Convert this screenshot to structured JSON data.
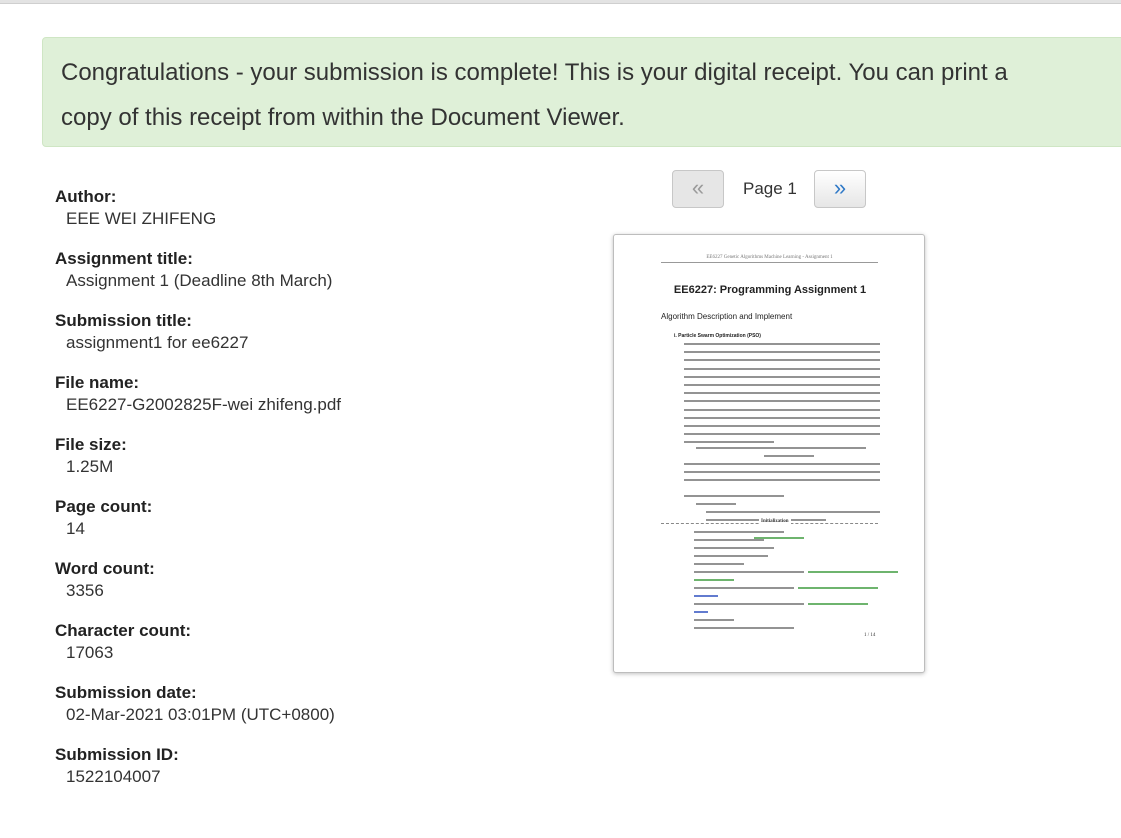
{
  "banner": {
    "line1": "Congratulations - your submission is complete! This is your digital receipt. You can print a",
    "line2": "copy of this receipt from within the Document Viewer."
  },
  "details": [
    {
      "label": "Author:",
      "value": "EEE WEI ZHIFENG"
    },
    {
      "label": "Assignment title:",
      "value": "Assignment 1 (Deadline 8th March)"
    },
    {
      "label": "Submission title:",
      "value": "assignment1 for ee6227"
    },
    {
      "label": "File name:",
      "value": "EE6227-G2002825F-wei zhifeng.pdf"
    },
    {
      "label": "File size:",
      "value": "1.25M"
    },
    {
      "label": "Page count:",
      "value": "14"
    },
    {
      "label": "Word count:",
      "value": "3356"
    },
    {
      "label": "Character count:",
      "value": "17063"
    },
    {
      "label": "Submission date:",
      "value": "02-Mar-2021 03:01PM (UTC+0800)"
    },
    {
      "label": "Submission ID:",
      "value": "1522104007"
    }
  ],
  "pager": {
    "prev_symbol": "«",
    "page_label": "Page 1",
    "next_symbol": "»"
  },
  "document_preview": {
    "header": "EE6227 Genetic Algorithms Machine Learning - Assignment 1",
    "title": "EE6227: Programming Assignment 1",
    "subtitle": "Algorithm Description and Implement",
    "section_heading": "i.    Particle Swarm Optimization (PSO)",
    "init_label": "Initialization",
    "page_number": "1 / 14"
  },
  "colors": {
    "banner_bg": "#dff0d8",
    "next_arrow": "#2f79c7",
    "code_comment": "#3d9b3d"
  }
}
